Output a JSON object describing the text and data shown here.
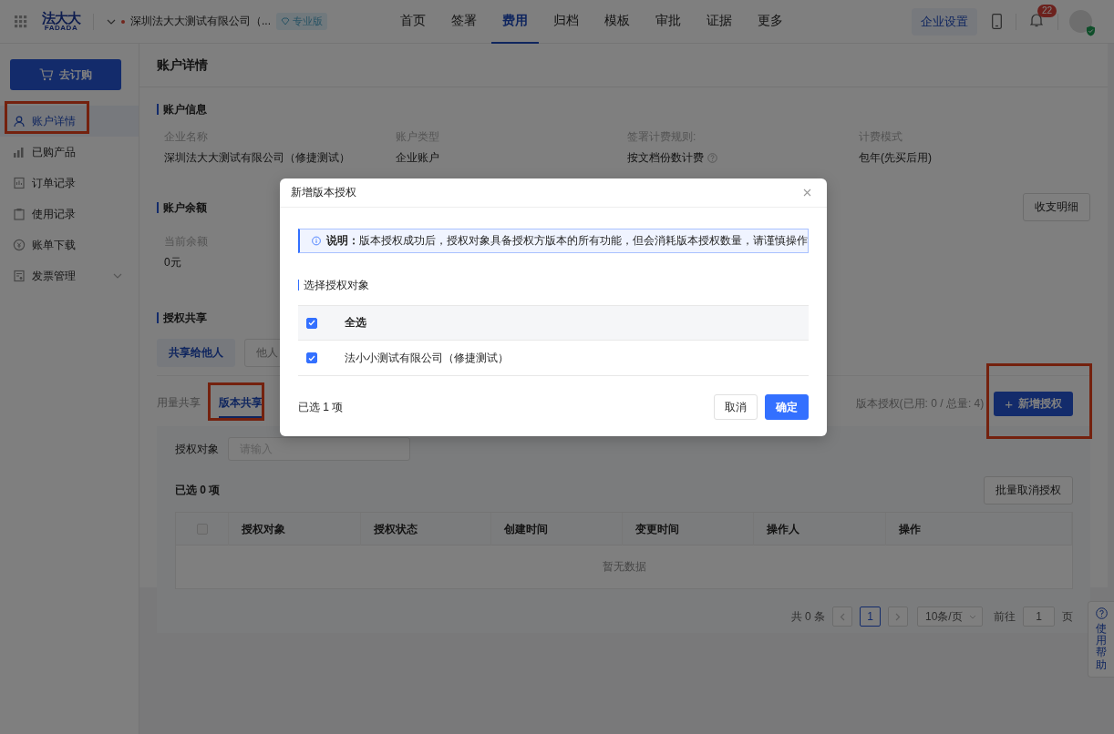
{
  "header": {
    "logo": {
      "name": "法大大",
      "latin": "FADADA"
    },
    "company": "深圳法大大测试有限公司（...",
    "edition": "专业版",
    "nav": [
      {
        "label": "首页",
        "selected": false
      },
      {
        "label": "签署",
        "selected": false
      },
      {
        "label": "费用",
        "selected": true
      },
      {
        "label": "归档",
        "selected": false
      },
      {
        "label": "模板",
        "selected": false
      },
      {
        "label": "审批",
        "selected": false
      },
      {
        "label": "证据",
        "selected": false
      },
      {
        "label": "更多",
        "selected": false
      }
    ],
    "settings_button": "企业设置",
    "notifications": "22"
  },
  "sidebar": {
    "order_button": "去订购",
    "items": [
      {
        "label": "账户详情",
        "kind": "link",
        "selected": true,
        "highlighted": true
      },
      {
        "label": "已购产品",
        "kind": "link",
        "selected": false,
        "highlighted": false
      },
      {
        "label": "订单记录",
        "kind": "link",
        "selected": false,
        "highlighted": false
      },
      {
        "label": "使用记录",
        "kind": "link",
        "selected": false,
        "highlighted": false
      },
      {
        "label": "账单下载",
        "kind": "link",
        "selected": false,
        "highlighted": false
      },
      {
        "label": "发票管理",
        "kind": "group",
        "selected": false,
        "highlighted": false
      }
    ]
  },
  "page_title": "账户详情",
  "account_info": {
    "title": "账户信息",
    "fields": [
      {
        "label": "企业名称",
        "value": "深圳法大大测试有限公司（修捷测试）",
        "kind": "plain"
      },
      {
        "label": "账户类型",
        "value": "企业账户",
        "kind": "plain"
      },
      {
        "label": "签署计费规则:",
        "value": "按文档份数计费",
        "kind": "help"
      },
      {
        "label": "计费模式",
        "value": "包年(先买后用)",
        "kind": "plain"
      }
    ]
  },
  "balance": {
    "title": "账户余额",
    "detail_button": "收支明细",
    "label": "当前余额",
    "value": "0元"
  },
  "sharing": {
    "title": "授权共享",
    "tabs": [
      {
        "label": "共享给他人",
        "selected": true
      },
      {
        "label": "他人",
        "selected": false
      }
    ],
    "subtabs": [
      {
        "label": "用量共享",
        "selected": false,
        "highlighted": false
      },
      {
        "label": "版本共享",
        "selected": true,
        "highlighted": true
      }
    ],
    "quota": "版本授权(已用: 0 / 总量: 4)",
    "add_button": {
      "icon": "+",
      "label": "新增授权",
      "highlighted": true
    },
    "filter": {
      "label": "授权对象",
      "placeholder": "请输入"
    },
    "selected_count": "已选 0 项",
    "batch_button": "批量取消授权",
    "table": {
      "select_all": {
        "checked": false
      },
      "columns": [
        "授权对象",
        "授权状态",
        "创建时间",
        "变更时间",
        "操作人",
        "操作"
      ],
      "empty_text": "暂无数据"
    },
    "pagination": {
      "total": "共 0 条",
      "pages": [
        {
          "label": "1",
          "selected": true
        }
      ],
      "page_size": "10条/页",
      "goto_label": "前往",
      "goto_value": "1",
      "goto_suffix": "页"
    }
  },
  "help_widget": {
    "label": "使用帮助"
  },
  "dialog": {
    "title": "新增版本授权",
    "notice": "**说明：**版本授权成功后，授权对象具备授权方版本的所有功能，但会消耗版本授权数量，请谨慎操作",
    "section_title": "选择授权对象",
    "select_all": {
      "label": "全选",
      "checked": true
    },
    "rows": [
      {
        "label": "法小小测试有限公司（修捷测试）",
        "checked": true
      }
    ],
    "selected_count": "已选 1 项",
    "cancel_button": "取消",
    "confirm_button": "确定"
  }
}
